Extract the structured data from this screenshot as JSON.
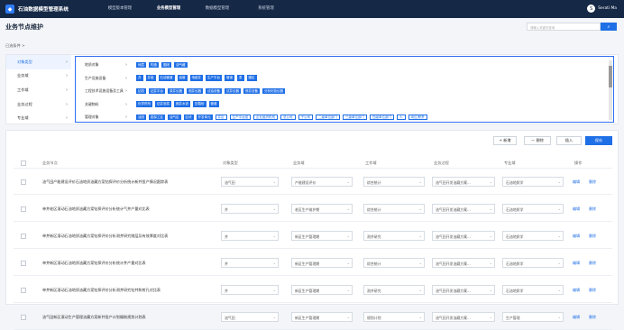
{
  "app": {
    "title": "石油数据模型管理系统",
    "logo": "◆"
  },
  "nav": [
    "模型版本管理",
    "业务模型管理",
    "数据模型管理",
    "系统管理"
  ],
  "user": {
    "name": "Serati Ma",
    "avatar": "S"
  },
  "page": {
    "title": "业务节点维护",
    "search_placeholder": "请输入关键字查询",
    "search_icon": "search-icon",
    "conditions": "已选条件 >"
  },
  "side": [
    {
      "label": "对象类型",
      "active": true
    },
    {
      "label": "业务域"
    },
    {
      "label": "工作域"
    },
    {
      "label": "业务过程"
    },
    {
      "label": "专业域"
    }
  ],
  "frows": [
    {
      "label": "地质对象",
      "tags": [
        "地层",
        "构造",
        "圈闭",
        "油气藏"
      ]
    },
    {
      "label": "生产设施设备",
      "tags": [
        "井",
        "井组",
        "石油管道",
        "油管",
        "电缆井",
        "生产平台",
        "管道",
        "泵",
        "罐区"
      ]
    },
    {
      "label": "工程技术设施设备及工具",
      "tags": [
        "钻机",
        "钻井平台",
        "录井仪器",
        "测井仪器",
        "试油设备",
        "试井仪器",
        "修井设备",
        "分析化验仪器"
      ]
    },
    {
      "label": "关键物料",
      "tags": [
        "化学药剂",
        "钻井泥浆",
        "固井水泥",
        "压裂砂",
        "管道"
      ]
    },
    {
      "label": "管理对象",
      "tags": [
        "油田",
        "勘探工区",
        "油气区",
        "区块",
        "开发单元",
        "井区",
        "生产平台组",
        "企业组织机构",
        "总公司",
        "子公司",
        "二级单位部门",
        "三级单位部门",
        "四级单位部门",
        "人",
        "岗位/职责"
      ],
      "outline_start": 5
    }
  ],
  "toolbar": {
    "add": "+ 新增",
    "delete": "— 删除",
    "insert": "插入",
    "save": "保存"
  },
  "columns": [
    "业务节点",
    "对象类型",
    "业务域",
    "工作域",
    "业务过程",
    "专业域",
    "操作"
  ],
  "rows": [
    {
      "node": "油气田产能建设评价石油地质油藏方案钻探评价分析统计新井投产情况跟踪表",
      "type": "油气田",
      "domain": "产能建设评价",
      "work": "综合统计",
      "process": "油气田开发油藏方案...",
      "major": "石油地质学"
    },
    {
      "node": "单井老区滚动石油地质油藏方案钻探评价分析统计气井产量对比表",
      "type": "井",
      "domain": "老区生产维护期",
      "work": "综合统计",
      "process": "油气田开发油藏方案...",
      "major": "石油地质学"
    },
    {
      "node": "单井新区滚动石油地质油藏方案钻探评价分析测井研究储层及有效厚度对比表",
      "type": "井",
      "domain": "新区生产管理期",
      "work": "测井研究",
      "process": "油气田开发油藏方案...",
      "major": "石油地质学"
    },
    {
      "node": "单井新区滚动石油地质油藏方案钻探评价分析统计井产量对比表",
      "type": "井",
      "domain": "新区生产管理期",
      "work": "综合统计",
      "process": "油气田开发油藏方案...",
      "major": "石油地质学"
    },
    {
      "node": "单井新区滚动石油地质油藏方案钻探评价分析测井研究钻井和射孔对比表",
      "type": "井",
      "domain": "新区生产管理期",
      "work": "测井研究",
      "process": "油气田开发油藏方案...",
      "major": "石油地质学"
    },
    {
      "node": "油气田新区滚动生产管理油藏方案新井投产计划编制规划计划表",
      "type": "油气田",
      "domain": "新区生产管理期",
      "work": "规划计划",
      "process": "油气田开发油藏方案...",
      "major": "生产管理"
    }
  ],
  "ops": {
    "edit": "编辑",
    "del": "删除"
  }
}
